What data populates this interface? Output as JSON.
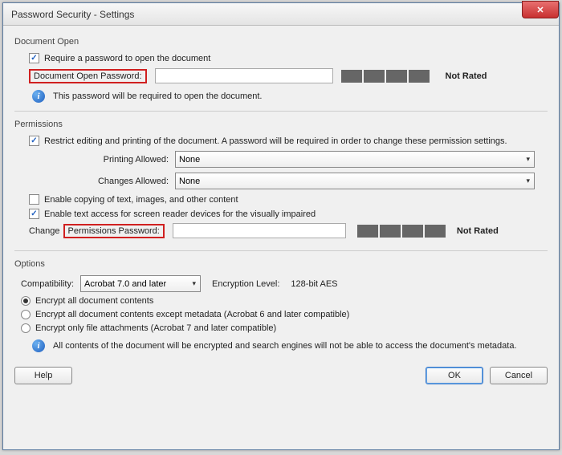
{
  "window": {
    "title": "Password Security - Settings"
  },
  "doc_open": {
    "section": "Document Open",
    "require_label": "Require a password to open the document",
    "pwd_label": "Document Open Password:",
    "pwd_value": "",
    "rating": "Not Rated",
    "info": "This password will be required to open the document."
  },
  "permissions": {
    "section": "Permissions",
    "restrict_label": "Restrict editing and printing of the document. A password will be required in order to change these permission settings.",
    "printing_label": "Printing Allowed:",
    "printing_value": "None",
    "changes_label": "Changes Allowed:",
    "changes_value": "None",
    "copy_label": "Enable copying of text, images, and other content",
    "sr_label": "Enable text access for screen reader devices for the visually impaired",
    "change_prefix": "Change",
    "change_pwd_label": "Permissions Password:",
    "change_pwd_value": "",
    "rating": "Not Rated"
  },
  "options": {
    "section": "Options",
    "compat_label": "Compatibility:",
    "compat_value": "Acrobat 7.0 and later",
    "enc_level_label": "Encryption Level:",
    "enc_level_value": "128-bit AES",
    "r_all": "Encrypt all document contents",
    "r_meta": "Encrypt all document contents except metadata (Acrobat 6 and later compatible)",
    "r_attach": "Encrypt only file attachments (Acrobat 7 and later compatible)",
    "info": "All contents of the document will be encrypted and search engines will not be able to access the document's metadata."
  },
  "footer": {
    "help": "Help",
    "ok": "OK",
    "cancel": "Cancel"
  }
}
